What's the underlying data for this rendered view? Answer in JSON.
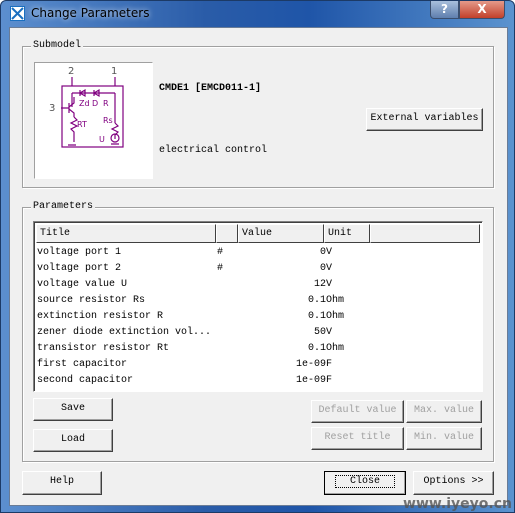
{
  "window": {
    "title": "Change Parameters",
    "help_glyph": "?",
    "close_glyph": "X"
  },
  "submodel": {
    "group_label": "Submodel",
    "name": "CMDE1 [EMCD011-1]",
    "description": "electrical control",
    "external_variables_label": "External variables",
    "schematic_labels": {
      "port1": "1",
      "port2": "2",
      "port3": "3",
      "zd": "Zd",
      "d": "D",
      "r": "R",
      "rs": "Rs",
      "rt": "RT",
      "u": "U"
    },
    "schematic_color": "#800080"
  },
  "parameters": {
    "group_label": "Parameters",
    "columns": [
      "Title",
      "",
      "Value",
      "Unit"
    ],
    "rows": [
      {
        "title": "voltage port 1",
        "flag": "#",
        "value": "0",
        "unit": "V"
      },
      {
        "title": "voltage port 2",
        "flag": "#",
        "value": "0",
        "unit": "V"
      },
      {
        "title": "voltage value U",
        "flag": "",
        "value": "12",
        "unit": "V"
      },
      {
        "title": "source resistor Rs",
        "flag": "",
        "value": "0.1",
        "unit": "Ohm"
      },
      {
        "title": "extinction resistor R",
        "flag": "",
        "value": "0.1",
        "unit": "Ohm"
      },
      {
        "title": "zener diode extinction vol...",
        "flag": "",
        "value": "50",
        "unit": "V"
      },
      {
        "title": "transistor resistor Rt",
        "flag": "",
        "value": "0.1",
        "unit": "Ohm"
      },
      {
        "title": "first capacitor",
        "flag": "",
        "value": "1e-09",
        "unit": "F"
      },
      {
        "title": "second capacitor",
        "flag": "",
        "value": "1e-09",
        "unit": "F"
      }
    ],
    "save_label": "Save",
    "load_label": "Load",
    "default_value_label": "Default value",
    "max_value_label": "Max. value",
    "reset_title_label": "Reset title",
    "min_value_label": "Min. value"
  },
  "footer": {
    "help_label": "Help",
    "close_label": "Close",
    "options_label": "Options >>"
  },
  "watermark": "www.iyeyo.cn"
}
